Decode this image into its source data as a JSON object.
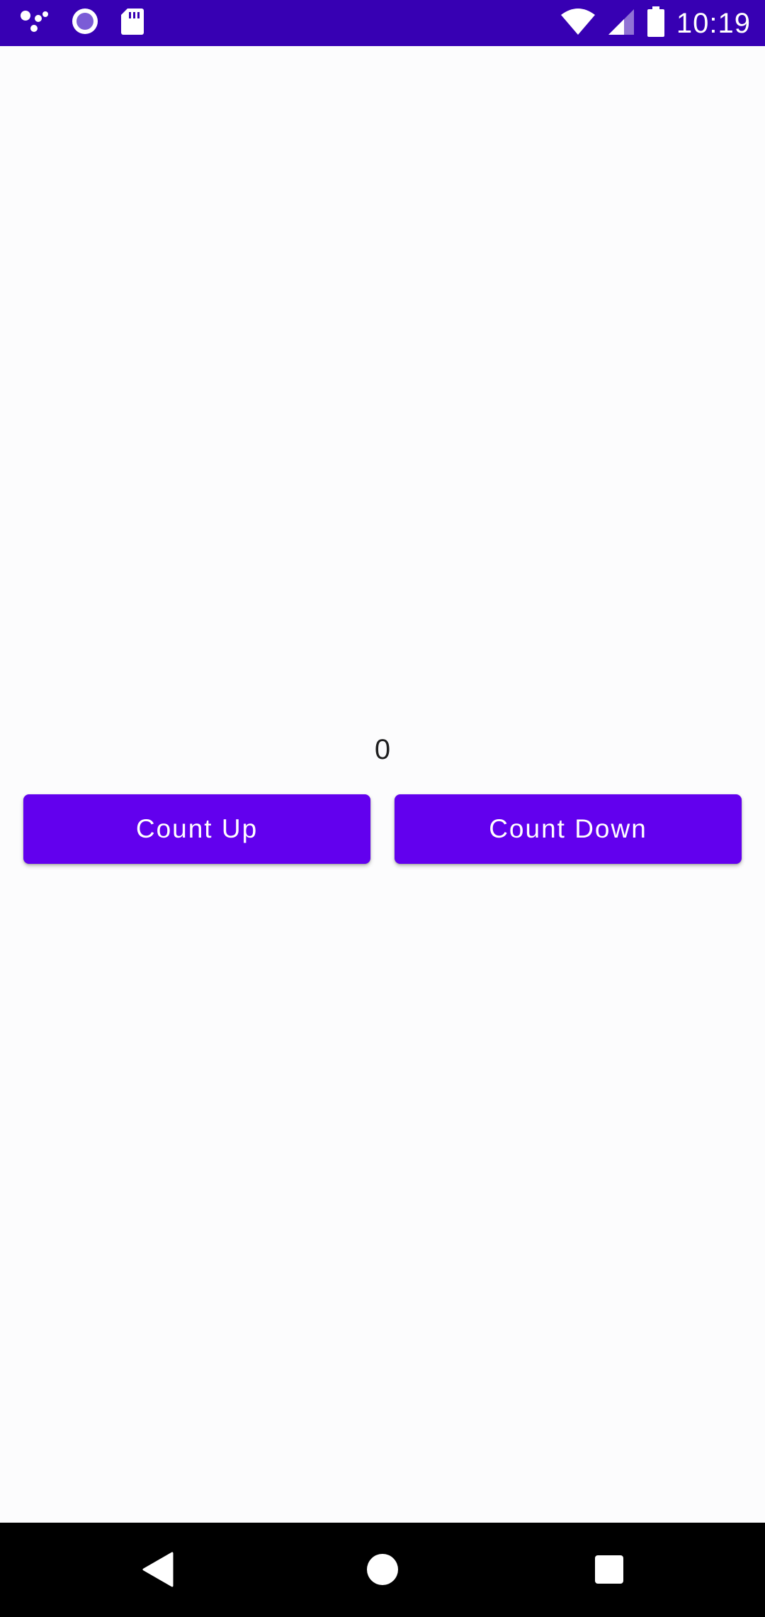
{
  "status_bar": {
    "time": "10:19",
    "background_color": "#3700b3",
    "left_icons": [
      "assistant-dots-icon",
      "record-circle-icon",
      "sd-card-icon"
    ],
    "right_icons": [
      "wifi-icon",
      "cell-signal-icon",
      "battery-icon"
    ]
  },
  "main": {
    "counter_value": "0",
    "count_up_label": "Count Up",
    "count_down_label": "Count Down",
    "button_color": "#6200ee"
  },
  "nav_bar": {
    "icons": [
      "back-icon",
      "home-icon",
      "recents-icon"
    ]
  }
}
